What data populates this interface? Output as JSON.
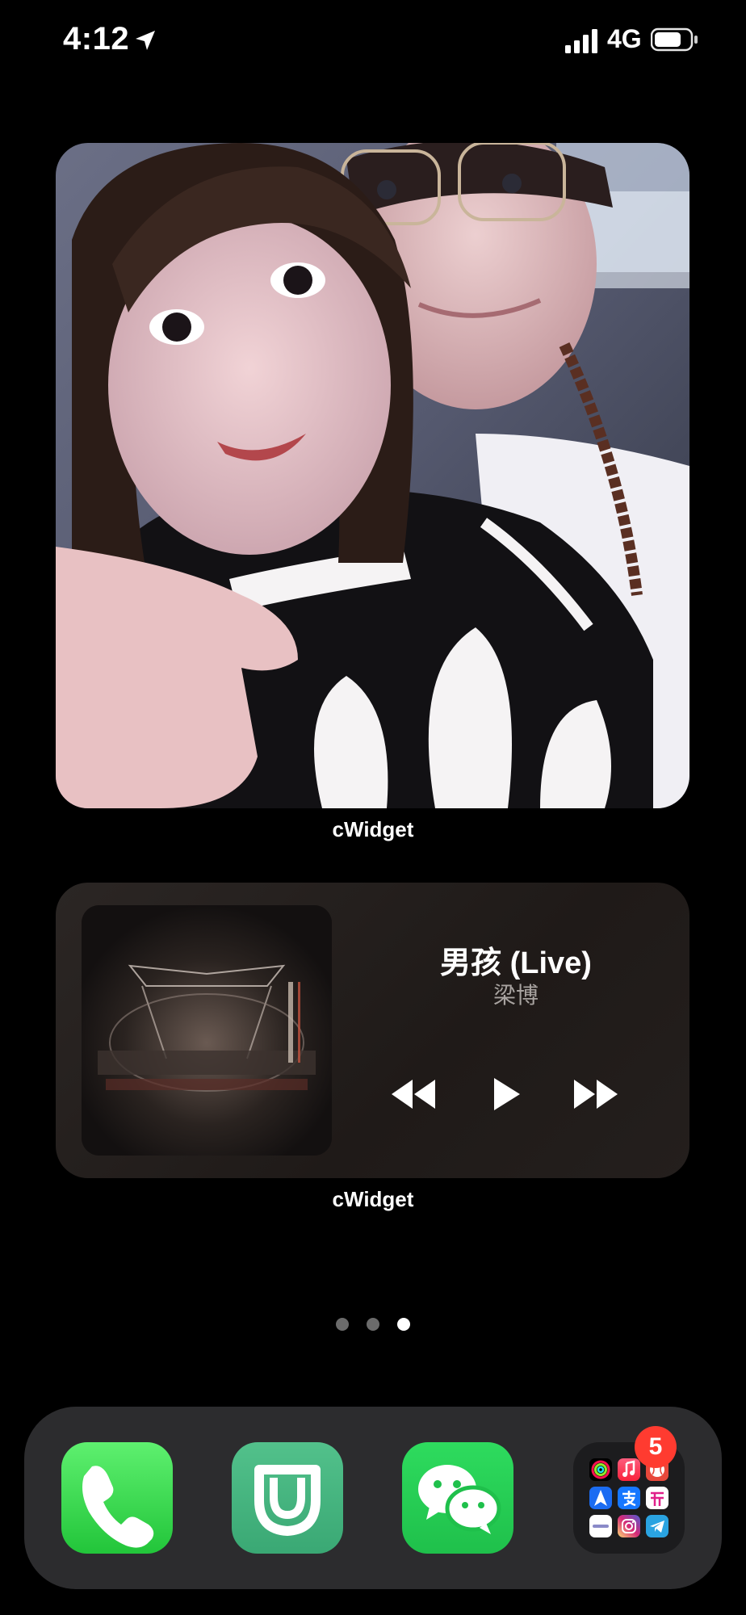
{
  "status_bar": {
    "time": "4:12",
    "network": "4G",
    "icons": [
      "location-arrow-icon",
      "cellular-signal-icon",
      "battery-icon"
    ]
  },
  "photo_widget": {
    "label": "cWidget"
  },
  "music_widget": {
    "label": "cWidget",
    "song_title": "男孩 (Live)",
    "artist": "梁博",
    "controls": [
      "backward-icon",
      "play-icon",
      "forward-icon"
    ]
  },
  "page_dots": {
    "count": 3,
    "active_index": 3
  },
  "dock": {
    "apps": [
      "phone-icon",
      "mijia-icon",
      "wechat-icon"
    ],
    "folder": {
      "badge": "5",
      "apps": [
        "activity-icon",
        "music-icon",
        "baseball-icon",
        "navigation-icon",
        "alipay-icon",
        "kaiyan-icon",
        "dots-icon",
        "instagram-icon",
        "telegram-icon"
      ]
    }
  },
  "colors": {
    "background": "#000000",
    "dock": "#2c2c2e",
    "badge": "#ff3b30",
    "phone_green": "#22c53a",
    "wechat_green": "#1fc04b",
    "mijia_green": "#3aa874"
  }
}
